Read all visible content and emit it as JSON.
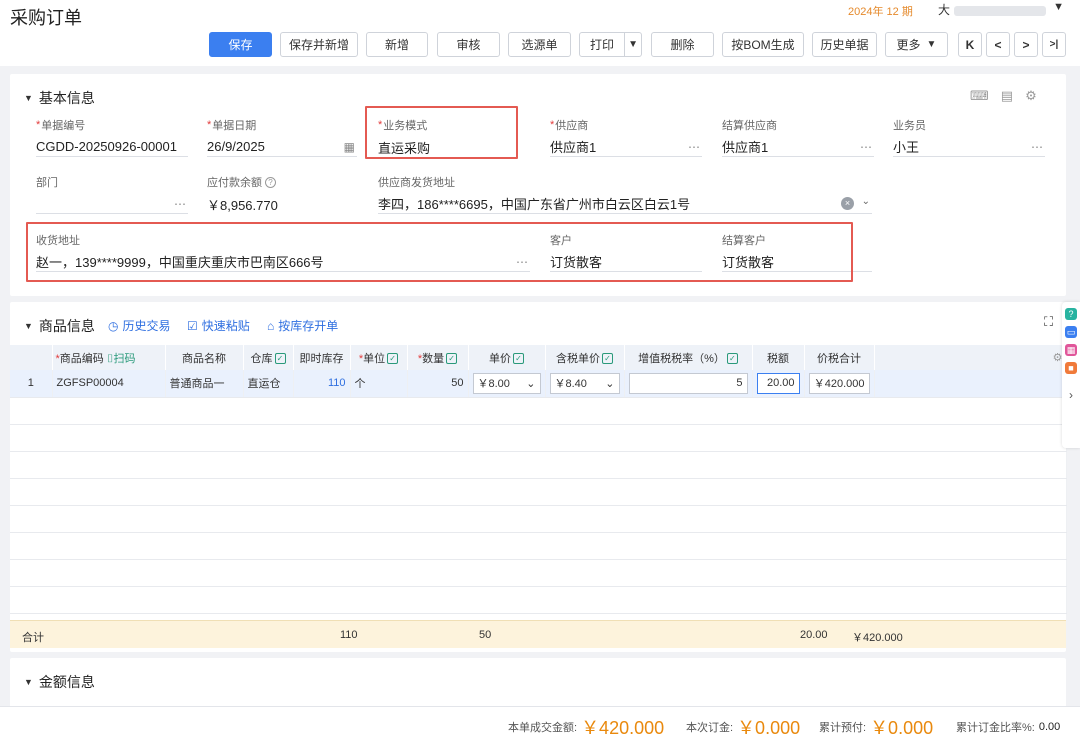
{
  "header": {
    "title": "采购订单",
    "period": "2024年 12 期",
    "org_prefix": "大",
    "org_chevron": "chevron-down-icon"
  },
  "toolbar": {
    "save": "保存",
    "save_new": "保存并新增",
    "add": "新增",
    "audit": "审核",
    "select_source": "选源单",
    "print": "打印",
    "delete": "删除",
    "bom": "按BOM生成",
    "history": "历史单据",
    "more": "更多",
    "nav_first": "K",
    "nav_prev": "<",
    "nav_next": ">",
    "nav_last": ">|"
  },
  "basic": {
    "title": "基本信息",
    "doc_no": {
      "label": "单据编号",
      "value": "CGDD-20250926-00001"
    },
    "doc_date": {
      "label": "单据日期",
      "value": "26/9/2025"
    },
    "biz_mode": {
      "label": "业务模式",
      "value": "直运采购"
    },
    "supplier": {
      "label": "供应商",
      "value": "供应商1"
    },
    "settle_supplier": {
      "label": "结算供应商",
      "value": "供应商1"
    },
    "salesman": {
      "label": "业务员",
      "value": "小王"
    },
    "dept": {
      "label": "部门",
      "value": ""
    },
    "payable": {
      "label": "应付款余额",
      "value": "￥8,956.770"
    },
    "ship_addr": {
      "label": "供应商发货地址",
      "value": "李四，186****6695，中国广东省广州市白云区白云1号"
    },
    "recv_addr": {
      "label": "收货地址",
      "value": "赵一，139****9999，中国重庆重庆市巴南区666号"
    },
    "customer": {
      "label": "客户",
      "value": "订货散客"
    },
    "settle_customer": {
      "label": "结算客户",
      "value": "订货散客"
    }
  },
  "goods": {
    "title": "商品信息",
    "link_history": "历史交易",
    "link_paste": "快速粘贴",
    "link_stock": "按库存开单",
    "scan": "扫码",
    "columns": [
      "商品编码",
      "商品名称",
      "仓库",
      "即时库存",
      "单位",
      "数量",
      "单价",
      "含税单价",
      "增值税税率（%）",
      "税额",
      "价税合计"
    ],
    "rows": [
      {
        "idx": "1",
        "code": "ZGFSP00004",
        "name": "普通商品一",
        "warehouse": "直运仓",
        "stock": "110",
        "unit": "个",
        "qty": "50",
        "price": "￥8.00",
        "tax_price": "￥8.40",
        "tax_rate": "5",
        "tax": "20.00",
        "total": "￥420.000"
      }
    ],
    "sum_label": "合计",
    "sum_stock": "110",
    "sum_qty": "50",
    "sum_tax": "20.00",
    "sum_total": "￥420.000"
  },
  "amount": {
    "title": "金额信息"
  },
  "footer": {
    "deal_label": "本单成交金额:",
    "deal_value": "￥420.000",
    "deposit_label": "本次订金:",
    "deposit_value": "￥0.000",
    "prepay_label": "累计预付:",
    "prepay_value": "￥0.000",
    "ratio_label": "累计订金比率%:",
    "ratio_value": "0.00"
  },
  "colors": {
    "primary": "#3b7ff0",
    "highlight": "#e45a52",
    "amount": "#e9890d"
  }
}
